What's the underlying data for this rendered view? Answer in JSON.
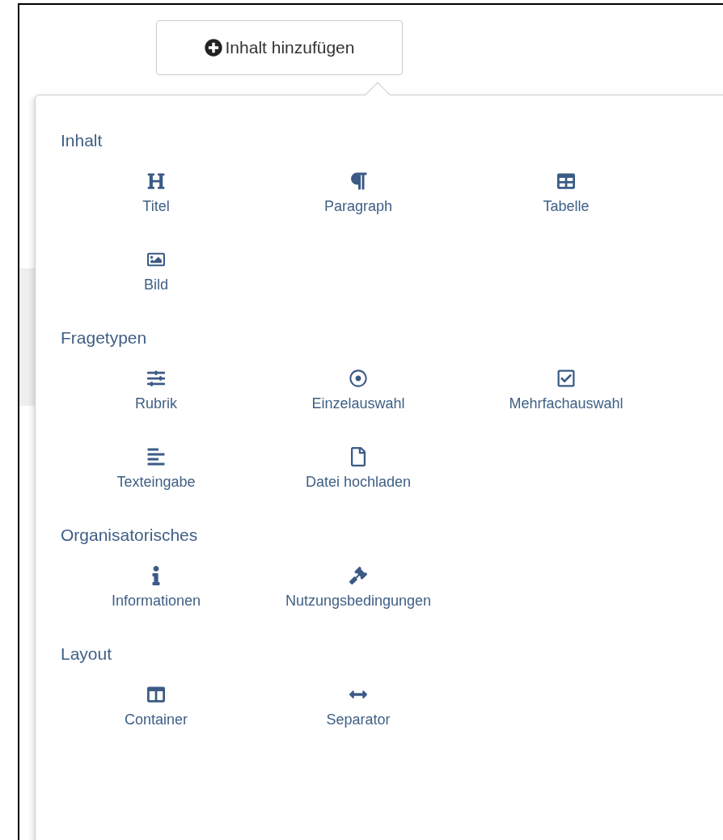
{
  "add_button": {
    "label": "Inhalt hinzufügen"
  },
  "sections": [
    {
      "title": "Inhalt",
      "items": [
        {
          "label": "Titel"
        },
        {
          "label": "Paragraph"
        },
        {
          "label": "Tabelle"
        },
        {
          "label": "Bild"
        }
      ]
    },
    {
      "title": "Fragetypen",
      "items": [
        {
          "label": "Rubrik"
        },
        {
          "label": "Einzelauswahl"
        },
        {
          "label": "Mehrfachauswahl"
        },
        {
          "label": "Texteingabe"
        },
        {
          "label": "Datei hochladen"
        }
      ]
    },
    {
      "title": "Organisatorisches",
      "items": [
        {
          "label": "Informationen"
        },
        {
          "label": "Nutzungsbedingungen"
        }
      ]
    },
    {
      "title": "Layout",
      "items": [
        {
          "label": "Container"
        },
        {
          "label": "Separator"
        }
      ]
    }
  ]
}
